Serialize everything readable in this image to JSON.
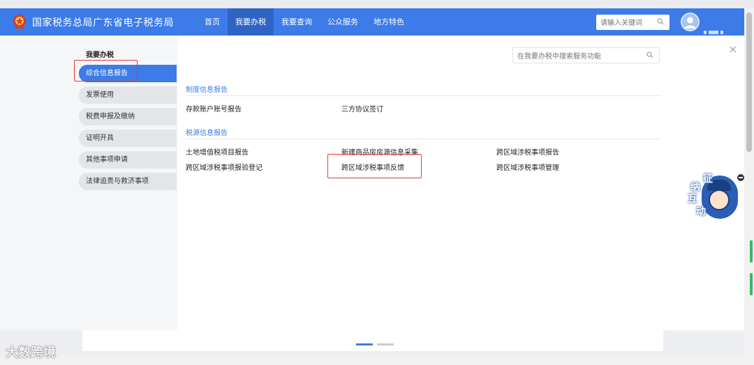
{
  "header": {
    "site_title": "国家税务总局广东省电子税务局",
    "nav": [
      "首页",
      "我要办税",
      "我要查询",
      "公众服务",
      "地方特色"
    ],
    "active_nav": "我要办税",
    "search_placeholder": "请输入关键词"
  },
  "sidebar": {
    "title": "我要办税",
    "items": [
      {
        "label": "综合信息报告"
      },
      {
        "label": "发票使用"
      },
      {
        "label": "税费申报及缴纳"
      },
      {
        "label": "证明开具"
      },
      {
        "label": "其他事项申请"
      },
      {
        "label": "法律追责与救济事项"
      }
    ]
  },
  "main": {
    "search_placeholder": "在我要办税中搜索服务功能",
    "close_symbol": "×",
    "sections": [
      {
        "title": "制度信息报告",
        "links": [
          "存款账户账号报告",
          "三方协议签订"
        ]
      },
      {
        "title": "税源信息报告",
        "links": [
          "土地增值税项目报告",
          "新建商品房房源信息采集",
          "跨区域涉税事项报告",
          "跨区域涉税事项报验登记",
          "跨区域涉税事项反馈",
          "跨区域涉税事项管理"
        ]
      }
    ]
  },
  "widget": {
    "chars": [
      "征",
      "纳",
      "互",
      "动"
    ]
  },
  "watermark": "大数跨境",
  "colors": {
    "primary": "#3c7be8",
    "nav_active": "#2f64c4",
    "highlight": "#e23a3a"
  }
}
